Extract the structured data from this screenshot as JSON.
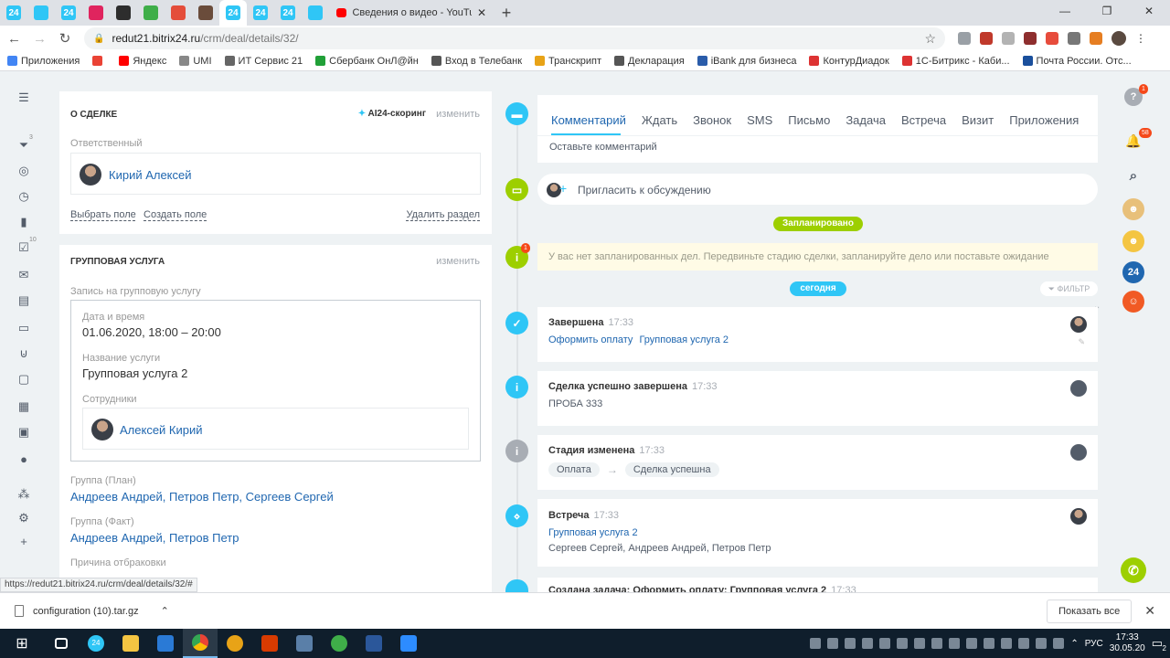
{
  "browser": {
    "mini_tabs": [
      {
        "label": "24",
        "color": "#2fc6f6"
      },
      {
        "label": "",
        "color": "#2fc6f6"
      },
      {
        "label": "24",
        "color": "#2fc6f6"
      },
      {
        "label": "",
        "color": "#e0245e"
      },
      {
        "label": "",
        "color": "#2d2d2d"
      },
      {
        "label": "",
        "color": "#3fae49"
      },
      {
        "label": "",
        "color": "#e44d3a"
      },
      {
        "label": "",
        "color": "#6a4c3b"
      },
      {
        "label": "24",
        "color": "#2fc6f6"
      },
      {
        "label": "24",
        "color": "#2fc6f6"
      },
      {
        "label": "24",
        "color": "#2fc6f6"
      },
      {
        "label": "",
        "color": "#2fc6f6"
      }
    ],
    "active_tab_title": "Сведения о видео - YouTube St",
    "url_host": "redut21.bitrix24.ru",
    "url_path": "/crm/deal/details/32/",
    "bookmarks": [
      {
        "label": "Приложения",
        "color": "#4285f4"
      },
      {
        "label": "",
        "color": "#ea4335"
      },
      {
        "label": "Яндекс",
        "color": "#f00"
      },
      {
        "label": "UMI",
        "color": "#888"
      },
      {
        "label": "ИТ Сервис 21",
        "color": "#666"
      },
      {
        "label": "Сбербанк ОнЛ@йн",
        "color": "#21a038"
      },
      {
        "label": "Вход в Телебанк",
        "color": "#555"
      },
      {
        "label": "Транскрипт",
        "color": "#e8a317"
      },
      {
        "label": "Декларация",
        "color": "#555"
      },
      {
        "label": "iBank для бизнеса",
        "color": "#2a5caa"
      },
      {
        "label": "КонтурДиадок",
        "color": "#d33"
      },
      {
        "label": "1С-Битрикс - Каби...",
        "color": "#d33"
      },
      {
        "label": "Почта России. Отс...",
        "color": "#1a4f9c"
      }
    ]
  },
  "deal": {
    "section_title": "О СДЕЛКЕ",
    "scoring": "AI24-скоринг",
    "edit": "изменить",
    "responsible_label": "Ответственный",
    "responsible_name": "Кирий Алексей",
    "select_field": "Выбрать поле",
    "create_field": "Создать поле",
    "delete_section": "Удалить раздел"
  },
  "group_service": {
    "section_title": "ГРУППОВАЯ УСЛУГА",
    "edit": "изменить",
    "booking_label": "Запись на групповую услугу",
    "datetime_label": "Дата и время",
    "datetime_value": "01.06.2020, 18:00 – 20:00",
    "service_label": "Название услуги",
    "service_value": "Групповая услуга 2",
    "staff_label": "Сотрудники",
    "staff_name": "Алексей Кирий",
    "plan_label": "Группа (План)",
    "plan_value": "Андреев Андрей, Петров Петр, Сергеев Сергей",
    "fact_label": "Группа (Факт)",
    "fact_value": "Андреев Андрей, Петров Петр",
    "reject_label": "Причина отбраковки"
  },
  "composer": {
    "tabs": [
      "Комментарий",
      "Ждать",
      "Звонок",
      "SMS",
      "Письмо",
      "Задача",
      "Встреча",
      "Визит",
      "Приложения"
    ],
    "placeholder": "Оставьте комментарий",
    "invite": "Пригласить к обсуждению"
  },
  "timeline": {
    "planned_label": "Запланировано",
    "planned_text": "У вас нет запланированных дел. Передвиньте стадию сделки, запланируйте дело или поставьте ожидание",
    "today_label": "сегодня",
    "filter": "ФИЛЬТР",
    "items": [
      {
        "title": "Завершена",
        "time": "17:33",
        "line1a": "Оформить оплату",
        "line1b": "Групповая услуга 2"
      },
      {
        "title": "Сделка успешно завершена",
        "time": "17:33",
        "line1": "ПРОБА 333"
      },
      {
        "title": "Стадия изменена",
        "time": "17:33",
        "from": "Оплата",
        "arrow": "→",
        "to": "Сделка успешна"
      },
      {
        "title": "Встреча",
        "time": "17:33",
        "line1": "Групповая услуга 2",
        "line2": "Сергеев Сергей, Андреев Андрей, Петров Петр"
      },
      {
        "title": "Создана задача: Оформить оплату: Групповая услуга 2",
        "time": "17:33"
      }
    ]
  },
  "right_panel": {
    "help_badge": "1",
    "notif_badge": "58",
    "b24": "24"
  },
  "statusbar_url": "https://redut21.bitrix24.ru/crm/deal/details/32/#",
  "download": {
    "file": "configuration (10).tar.gz",
    "show_all": "Показать все"
  },
  "taskbar": {
    "lang": "РУС",
    "time": "17:33",
    "date": "30.05.20",
    "notif_count": "2",
    "b24": "24"
  }
}
